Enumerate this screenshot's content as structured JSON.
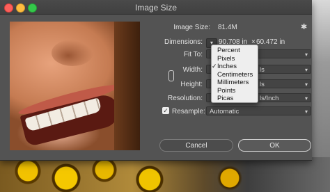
{
  "window": {
    "title": "Image Size"
  },
  "image_size": {
    "label": "Image Size:",
    "value": "81.4M"
  },
  "dimensions": {
    "label": "Dimensions:",
    "width": "90.708 in",
    "separator": "×",
    "height": "60.472 in"
  },
  "fit_to": {
    "label": "Fit To:"
  },
  "width": {
    "label": "Width:",
    "unit_partial": "ls"
  },
  "height": {
    "label": "Height:",
    "unit_partial": "ls"
  },
  "resolution": {
    "label": "Resolution:",
    "unit_partial": "ls/Inch"
  },
  "resample": {
    "label": "Resample:",
    "checked": true,
    "value": "Automatic"
  },
  "units_menu": {
    "items": [
      "Percent",
      "Pixels",
      "Inches",
      "Centimeters",
      "Millimeters",
      "Points",
      "Picas"
    ],
    "selected": "Inches"
  },
  "buttons": {
    "cancel": "Cancel",
    "ok": "OK"
  },
  "icons": {
    "gear": "gear-icon",
    "link": "chain-link-icon",
    "chevron": "chevron-down-icon",
    "check": "checkmark-icon"
  },
  "colors": {
    "dialog_bg": "#535353",
    "close": "#fc605b",
    "minimize": "#fdbc40",
    "zoom": "#34c84a",
    "menu_bg": "#eeeeee"
  }
}
